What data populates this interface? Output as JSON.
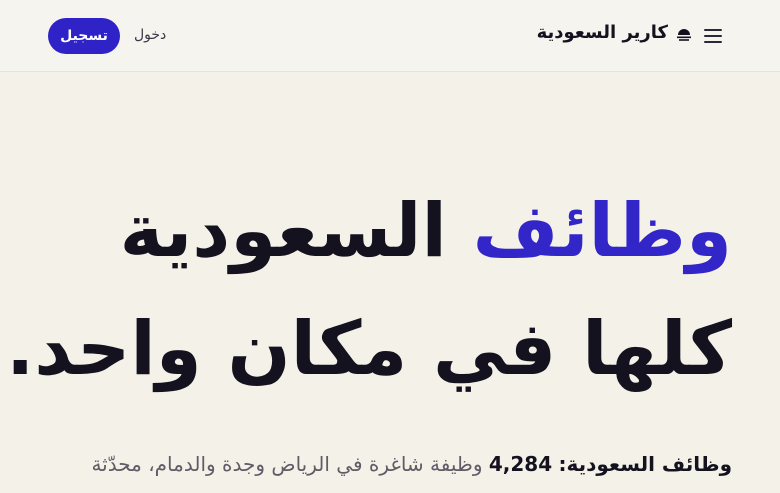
{
  "header": {
    "brand_name": "كارير السعودية",
    "logo_icon": "sunrise-icon",
    "menu_icon": "hamburger-menu-icon",
    "login_label": "دخول",
    "signup_label": "تسجيل"
  },
  "hero": {
    "line1_accent": "وظائف",
    "line1_rest": "السعودية",
    "line2": "كلها في مكان واحد."
  },
  "subtitle": {
    "lead": "وظائف السعودية:",
    "count": "4,284",
    "text": "وظيفة شاغرة في الرياض وجدة والدمام، محدّثة"
  },
  "colors": {
    "accent": "#3326c9",
    "signup_bg": "#2f22c7",
    "background": "#f4f1e9",
    "text": "#14121e"
  }
}
